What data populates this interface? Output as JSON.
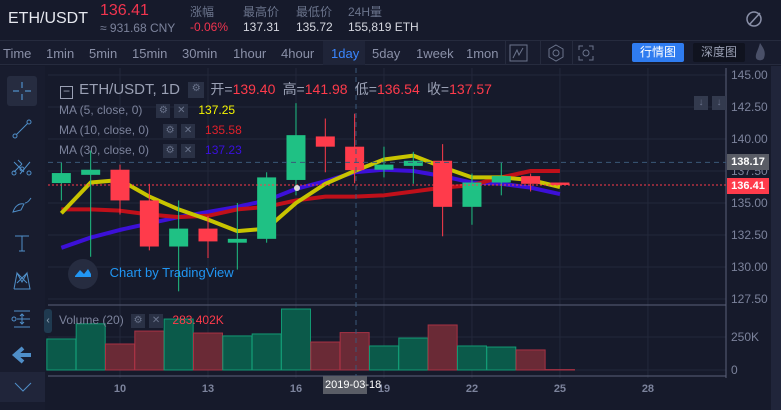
{
  "header": {
    "pair": "ETH/USDT",
    "price": "136.41",
    "cny": "≈ 931.68 CNY",
    "stats": [
      {
        "label": "涨幅",
        "value": "-0.06%",
        "color": "#f0344f"
      },
      {
        "label": "最高价",
        "value": "137.31",
        "color": "#d6d8e0"
      },
      {
        "label": "最低价",
        "value": "135.72",
        "color": "#d6d8e0"
      },
      {
        "label": "24H量",
        "value": "155,819 ETH",
        "color": "#d6d8e0"
      }
    ]
  },
  "toolbar": {
    "intervals": [
      "Time",
      "1min",
      "5min",
      "15min",
      "30min",
      "1hour",
      "4hour",
      "1day",
      "5day",
      "1week",
      "1mon"
    ],
    "active": "1day",
    "view_market": "行情图",
    "view_depth": "深度图"
  },
  "legend": {
    "title": "ETH/USDT, 1D",
    "open_label": "开=",
    "open": "139.40",
    "high_label": "高=",
    "high": "141.98",
    "low_label": "低=",
    "low": "136.54",
    "close_label": "收=",
    "close": "137.57",
    "ma": [
      {
        "label": "MA (5, close, 0)",
        "value": "137.25",
        "color": "#f5f500"
      },
      {
        "label": "MA (10, close, 0)",
        "value": "135.58",
        "color": "#e0202a"
      },
      {
        "label": "MA (30, close, 0)",
        "value": "137.23",
        "color": "#3a10e0"
      }
    ],
    "volume_label": "Volume (20)",
    "volume_value": "283.402K"
  },
  "watermark": "Chart by TradingView",
  "crosshair": {
    "date": "2019-03-18",
    "price": "138.17"
  },
  "last_price": "136.41",
  "colors": {
    "up": "#1fc184",
    "down": "#ff3b4b",
    "ma5": "#c8c400",
    "ma10": "#c0101a",
    "ma30": "#3c10d8",
    "accent": "#2f7cf0"
  },
  "chart_data": {
    "type": "candlestick",
    "days": [
      8,
      9,
      10,
      11,
      12,
      13,
      14,
      15,
      16,
      17,
      18,
      19,
      20,
      21,
      22,
      23,
      24,
      25
    ],
    "ohlc": [
      [
        136.56,
        138.2,
        135.2,
        137.34
      ],
      [
        137.2,
        139.1,
        130.8,
        137.6
      ],
      [
        137.6,
        138.0,
        134.1,
        135.2
      ],
      [
        135.2,
        136.5,
        131.3,
        131.6
      ],
      [
        131.6,
        135.2,
        128.1,
        133.0
      ],
      [
        133.0,
        134.0,
        130.7,
        132.0
      ],
      [
        131.9,
        135.0,
        129.8,
        132.2
      ],
      [
        132.2,
        137.4,
        131.9,
        137.0
      ],
      [
        136.8,
        142.8,
        135.6,
        140.3
      ],
      [
        140.2,
        141.6,
        137.4,
        139.4
      ],
      [
        139.4,
        141.98,
        136.54,
        137.57
      ],
      [
        137.6,
        139.4,
        137.0,
        138.0
      ],
      [
        137.9,
        139.0,
        136.5,
        138.3
      ],
      [
        138.3,
        139.6,
        132.4,
        134.7
      ],
      [
        134.7,
        137.3,
        133.3,
        136.6
      ],
      [
        136.6,
        138.2,
        135.6,
        137.1
      ],
      [
        137.1,
        137.3,
        135.9,
        136.5
      ],
      [
        136.6,
        136.6,
        136.41,
        136.41
      ]
    ],
    "ma5": [
      134.2,
      136.6,
      136.8,
      135.5,
      134.5,
      133.7,
      132.8,
      133.0,
      135.0,
      136.5,
      137.5,
      138.4,
      138.7,
      137.8,
      137.0,
      137.0,
      136.8,
      136.25
    ],
    "ma10": [
      134.5,
      134.5,
      134.4,
      134.1,
      133.9,
      134.0,
      134.5,
      134.7,
      135.2,
      135.5,
      135.5,
      135.6,
      135.9,
      136.2,
      136.4,
      137.0,
      137.5,
      137.5
    ],
    "ma30": [
      131.5,
      132.3,
      132.9,
      133.4,
      133.9,
      134.3,
      134.7,
      135.2,
      136.1,
      136.7,
      137.4,
      137.6,
      137.5,
      137.1,
      136.6,
      136.5,
      136.2,
      135.7
    ],
    "volume_k": [
      235,
      350,
      197,
      295,
      386,
      280,
      258,
      273,
      462,
      212,
      283.4,
      182,
      242,
      341,
      182,
      174,
      152,
      3
    ],
    "price_ticks": [
      "145.00",
      "142.50",
      "140.00",
      "137.50",
      "135.00",
      "132.50",
      "130.00",
      "127.50"
    ],
    "price_tick_values": [
      145,
      142.5,
      140,
      137.5,
      135,
      132.5,
      130,
      127.5
    ],
    "volume_ticks": [
      "250K",
      "0"
    ],
    "volume_tick_values": [
      250,
      0
    ],
    "x_ticks": [
      "10",
      "13",
      "16",
      "19",
      "22",
      "25",
      "28"
    ],
    "x_tick_values": [
      10,
      13,
      16,
      19,
      22,
      25,
      28
    ]
  }
}
